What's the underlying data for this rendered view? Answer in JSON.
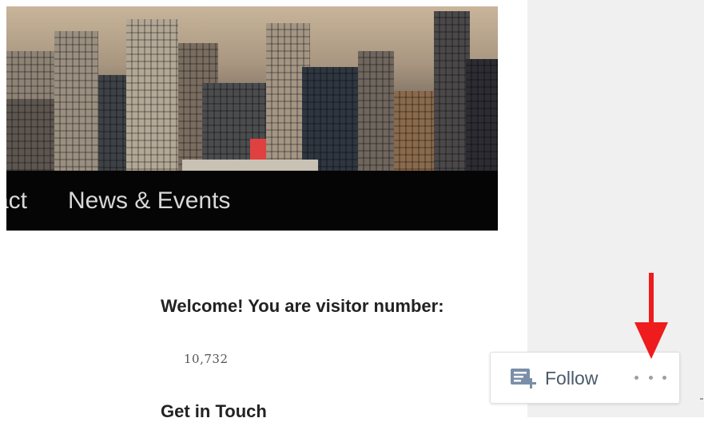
{
  "nav": {
    "items": [
      {
        "label": "act"
      },
      {
        "label": "News & Events"
      }
    ]
  },
  "widget": {
    "welcome_text": "Welcome! You are visitor number:",
    "visitor_count": "10,732",
    "get_in_touch": "Get in Touch"
  },
  "follow_bar": {
    "follow_label": "Follow",
    "follow_icon": "follow-reader-icon",
    "more_icon": "more-horizontal-icon"
  },
  "annotation": {
    "arrow_color": "#ee1c1c"
  }
}
